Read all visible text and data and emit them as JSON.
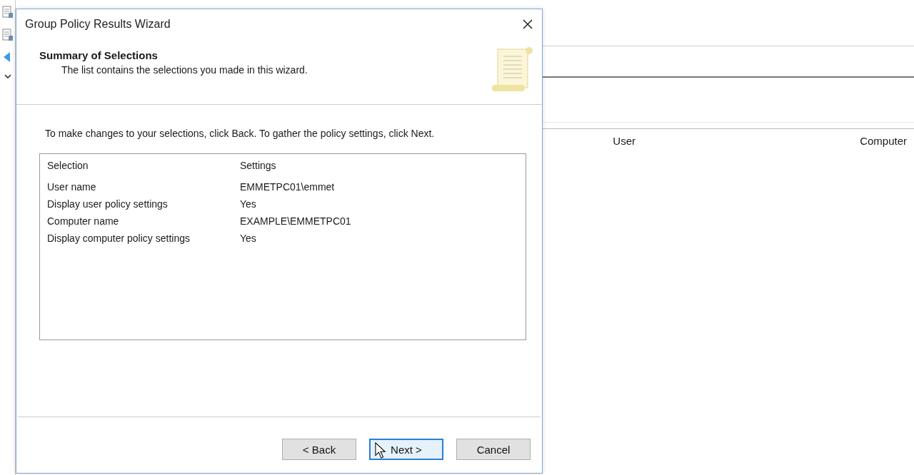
{
  "background": {
    "columns": [
      "User",
      "Computer"
    ]
  },
  "dialog": {
    "title": "Group Policy Results Wizard",
    "heading": "Summary of Selections",
    "subtitle": "The list contains the selections you made in this wizard.",
    "instruction": "To make changes to your selections, click Back. To gather the policy settings, click Next.",
    "list": {
      "columns": [
        "Selection",
        "Settings"
      ],
      "rows": [
        {
          "selection": "User name",
          "setting": "EMMETPC01\\emmet"
        },
        {
          "selection": "Display user policy settings",
          "setting": "Yes"
        },
        {
          "selection": "Computer name",
          "setting": "EXAMPLE\\EMMETPC01"
        },
        {
          "selection": "Display computer policy settings",
          "setting": "Yes"
        }
      ]
    },
    "buttons": [
      {
        "label": "< Back",
        "focused": false
      },
      {
        "label": "Next >",
        "focused": true
      },
      {
        "label": "Cancel",
        "focused": false
      }
    ]
  }
}
